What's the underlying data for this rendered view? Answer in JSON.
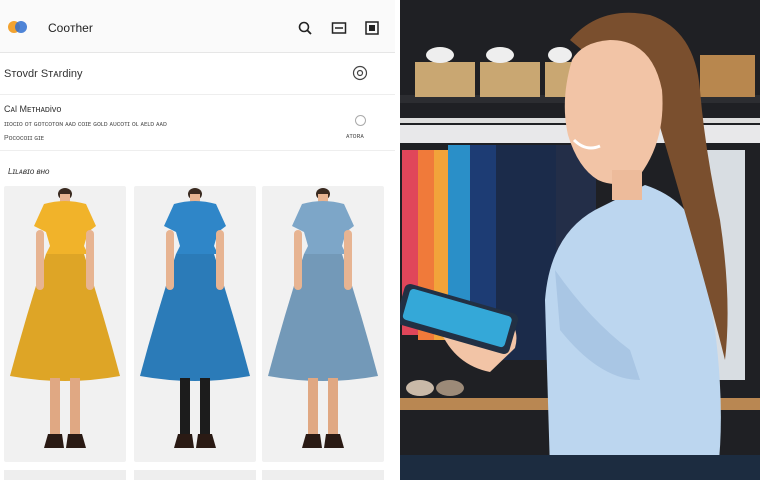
{
  "app": {
    "title": "Cᴏᴏᴛher",
    "icons": {
      "logo": "logo-icon",
      "search": "search-icon",
      "window": "window-icon",
      "settings": "square-icon"
    }
  },
  "search": {
    "label": "Sᴛoᴠdr Sᴛᴀrdiny",
    "button_icon": "info-icon"
  },
  "section": {
    "title": "Cᴀl Mᴇᴛʜᴀᴅiᴠᴏ",
    "description": "ɪɪᴏᴄɪᴏ ᴏᴛ ɢᴏᴛᴄᴏᴛᴏɴ ᴀᴀᴅ ᴄᴏɪᴇ ɢᴏʟᴅ ᴀᴜᴄᴏᴛɪ ᴏʟ ᴀᴇʟᴅ ᴀᴀᴅ",
    "note": "Pᴏᴄᴏᴄᴏɪɪ ɢɪᴇ",
    "option_label": "ᴀᴛᴏʀᴀ"
  },
  "products": {
    "label": "Lɪʟᴀʙɪᴏ ʙʜᴏ",
    "items": [
      {
        "color": "#f1b32a",
        "name": "yellow-dress"
      },
      {
        "color": "#2f86c8",
        "name": "blue-dress"
      },
      {
        "color": "#7da6c8",
        "name": "light-blue-dress"
      }
    ]
  }
}
